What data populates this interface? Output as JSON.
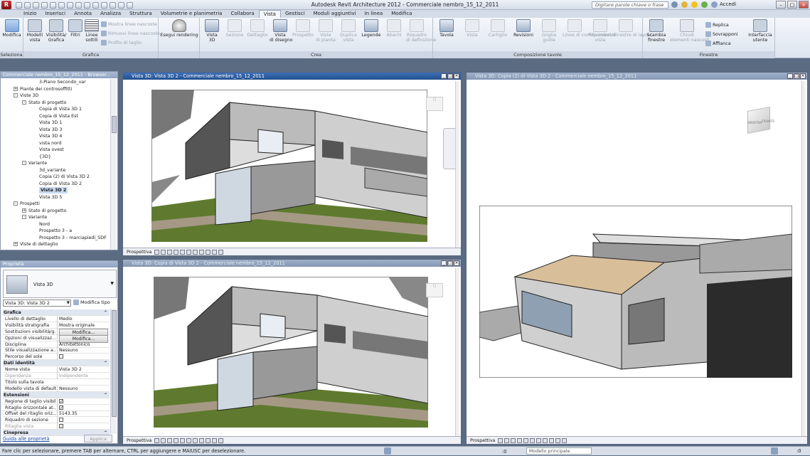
{
  "app": {
    "title": "Autodesk Revit Architecture 2012 -   Commerciale nembro_15_12_2011",
    "search_placeholder": "Digitare parole chiave o frase",
    "accedi": "Accedi",
    "app_button": "R"
  },
  "tabs": [
    "Inizio",
    "Inserisci",
    "Annota",
    "Analizza",
    "Struttura",
    "Volumetrie e planimetria",
    "Collabora",
    "Vista",
    "Gestisci",
    "Moduli aggiuntivi",
    "In linea",
    "Modifica"
  ],
  "active_tab": "Vista",
  "ribbon": {
    "seleziona": {
      "label": "Seleziona",
      "modifica": "Modifica"
    },
    "grafica": {
      "label": "Grafica",
      "modelli_vista": "Modelli\nvista",
      "visibilita": "Visibilità/\nGrafica",
      "filtri": "Filtri",
      "linee_sottili": "Linee\nsottili",
      "mostra_linee": "Mostra linee nascoste",
      "rimuovi_linee": "Rimuovi linee nascoste",
      "profilo_taglio": "Profilo di taglio"
    },
    "esegui_rendering": "Esegui rendering",
    "crea": {
      "label": "Crea",
      "items": [
        {
          "label": "Vista\n3D",
          "enabled": true
        },
        {
          "label": "Sezione",
          "enabled": false
        },
        {
          "label": "Dettaglio",
          "enabled": false
        },
        {
          "label": "Vista\ndi disegno",
          "enabled": true
        },
        {
          "label": "Prospetto",
          "enabled": false
        },
        {
          "label": "Viste\ndi pianta",
          "enabled": false
        },
        {
          "label": "Duplica\nvista",
          "enabled": false
        },
        {
          "label": "Legende",
          "enabled": true
        },
        {
          "label": "Abachi",
          "enabled": false
        },
        {
          "label": "Riquadro\ndi definizione",
          "enabled": false
        }
      ]
    },
    "composizione": {
      "label": "Composizione tavole",
      "items": [
        {
          "label": "Tavola",
          "enabled": true
        },
        {
          "label": "Vista",
          "enabled": false
        },
        {
          "label": "Cartiglio",
          "enabled": false
        },
        {
          "label": "Revisioni",
          "enabled": true
        },
        {
          "label": "Griglia\nguida",
          "enabled": false
        },
        {
          "label": "Linee di corrispondenza",
          "enabled": false
        },
        {
          "label": "Riferimento\nvista",
          "enabled": false
        },
        {
          "label": "Finestre di layout",
          "enabled": false
        }
      ]
    },
    "finestre": {
      "label": "Finestre",
      "cambia": "Scambia\nfinestre",
      "chiudi": "Chiudi\nelementi nascosti",
      "replica": "Replica",
      "sovrapponi": "Sovrapponi",
      "affianca": "Affianca",
      "interfaccia": "Interfaccia\nutente"
    }
  },
  "browser": {
    "title": "Commerciale nembro_15_12_2011 - Browser...",
    "items": [
      {
        "text": "3-Piano Secondo_var",
        "level": 4
      },
      {
        "text": "Piante dei controsoffitti",
        "level": 1,
        "box": "+"
      },
      {
        "text": "Viste 3D",
        "level": 1,
        "box": "-"
      },
      {
        "text": "Stato di progetto",
        "level": 2,
        "box": "-"
      },
      {
        "text": "Copia di Vista 3D 1",
        "level": 4
      },
      {
        "text": "Copia di Vista Est",
        "level": 4
      },
      {
        "text": "Vista 3D 1",
        "level": 4
      },
      {
        "text": "Vista 3D 3",
        "level": 4
      },
      {
        "text": "Vista 3D 4",
        "level": 4
      },
      {
        "text": "vista nord",
        "level": 4
      },
      {
        "text": "Vista ovest",
        "level": 4
      },
      {
        "text": "{3D}",
        "level": 4
      },
      {
        "text": "Variante",
        "level": 2,
        "box": "-"
      },
      {
        "text": "3d_variante",
        "level": 4
      },
      {
        "text": "Copia (2) di Vista 3D 2",
        "level": 4
      },
      {
        "text": "Copia di Vista 3D 2",
        "level": 4
      },
      {
        "text": "Vista 3D 2",
        "level": 4,
        "selected": true
      },
      {
        "text": "Vista 3D 5",
        "level": 4
      },
      {
        "text": "Prospetti",
        "level": 1,
        "box": "-"
      },
      {
        "text": "Stato di progetto",
        "level": 2,
        "box": "+"
      },
      {
        "text": "Variante",
        "level": 2,
        "box": "-"
      },
      {
        "text": "Nord",
        "level": 4
      },
      {
        "text": "Prospetto 3 - a",
        "level": 4
      },
      {
        "text": "Prospetto 3 - marciapiedi_SDF",
        "level": 4
      },
      {
        "text": "Viste di dettaglio",
        "level": 1,
        "box": "+"
      }
    ]
  },
  "properties": {
    "title": "Proprietà",
    "type_name": "Vista 3D",
    "selector": "Vista 3D: Vista 3D 2",
    "modifica_tipo": "Modifica tipo",
    "rows": [
      {
        "k": "Grafica",
        "group": true
      },
      {
        "k": "Livello di dettaglio",
        "v": "Medio"
      },
      {
        "k": "Visibilità stratigrafia",
        "v": "Mostra originale"
      },
      {
        "k": "Sostituzioni visibilità/g...",
        "v": "Modifica...",
        "button": true
      },
      {
        "k": "Opzioni di visualizzaz...",
        "v": "Modifica...",
        "button": true
      },
      {
        "k": "Disciplina",
        "v": "Architettonico"
      },
      {
        "k": "Stile visualizzazione a...",
        "v": "Nessuno"
      },
      {
        "k": "Percorso del sole",
        "v": "",
        "check": false
      },
      {
        "k": "Dati identità",
        "group": true
      },
      {
        "k": "Nome vista",
        "v": "Vista 3D 2"
      },
      {
        "k": "Dipendenza",
        "v": "Indipendente",
        "muted": true
      },
      {
        "k": "Titolo sulla tavola",
        "v": ""
      },
      {
        "k": "Modello vista di default",
        "v": "Nessuno"
      },
      {
        "k": "Estensioni",
        "group": true
      },
      {
        "k": "Regione di taglio visibile",
        "v": "",
        "check": true
      },
      {
        "k": "Ritaglio orizzontale at...",
        "v": "",
        "check": true
      },
      {
        "k": "Offset del ritaglio oriz...",
        "v": "5143.35"
      },
      {
        "k": "Riquadro di sezione",
        "v": "",
        "check": false
      },
      {
        "k": "Ritaglia vista",
        "v": "",
        "check": true,
        "muted": true
      },
      {
        "k": "Cinepresa",
        "group": true
      }
    ],
    "guida": "Guida alle proprietà",
    "applica": "Applica"
  },
  "views": [
    {
      "title": "Vista 3D: Vista 3D 2 - Commerciale nembro_15_12_2011",
      "active": true,
      "footer": "Prospettiva"
    },
    {
      "title": "Vista 3D: Copia di Vista 3D 2 - Commerciale nembro_15_12_2011",
      "active": false,
      "footer": "Prospettiva"
    },
    {
      "title": "Vista 3D: Copia (2) di Vista 3D 2 - Commerciale nembro_15_12_2011",
      "active": false,
      "footer": "Prospettiva"
    }
  ],
  "viewcube": {
    "left": "SINISTRA",
    "front": "FRONTE"
  },
  "status": {
    "message": "Fare clic per selezionare, premere TAB per alternare, CTRL per aggiungere e MAIUSC per deselezionare.",
    "workset": "Modello principale",
    "zero": ":0"
  }
}
